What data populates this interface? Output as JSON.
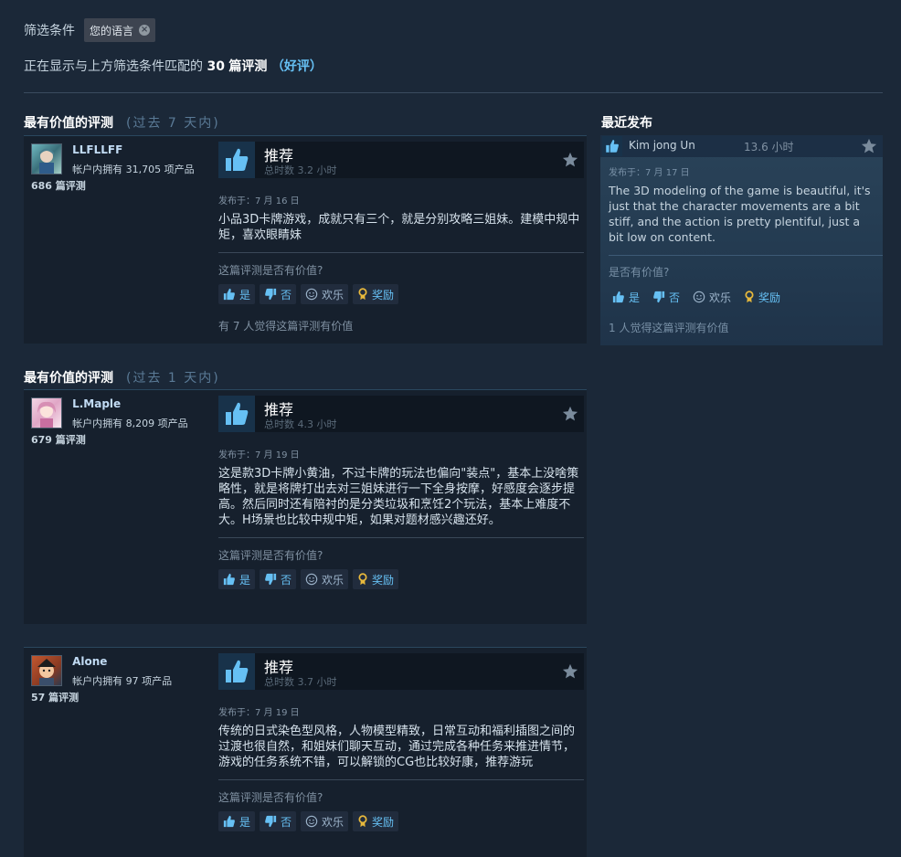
{
  "filter": {
    "label": "筛选条件",
    "chip": "您的语言"
  },
  "summary": {
    "prefix": "正在显示与上方筛选条件匹配的",
    "count": "30",
    "suffix": "篇评测",
    "paren_open": "（",
    "type": "好评",
    "paren_close": "）"
  },
  "sections": [
    {
      "title": "最有价值的评测",
      "period": "(过去 7 天内)"
    },
    {
      "title": "最有价值的评测",
      "period": "(过去 1 天内)"
    }
  ],
  "reviews": [
    {
      "author": "LLFLLFF",
      "products": "帐户内拥有 31,705 项产品",
      "review_count": "686 篇评测",
      "recommendation": "推荐",
      "hours": "总时数 3.2 小时",
      "posted": "发布于：7 月 16 日",
      "text": "小品3D卡牌游戏，成就只有三个，就是分别攻略三姐妹。建模中规中矩，喜欢眼睛妹",
      "helpful_q": "这篇评测是否有价值?",
      "found_helpful": "有 7 人觉得这篇评测有价值"
    },
    {
      "author": "L.Maple",
      "products": "帐户内拥有 8,209 项产品",
      "review_count": "679 篇评测",
      "recommendation": "推荐",
      "hours": "总时数 4.3 小时",
      "posted": "发布于：7 月 19 日",
      "text": "这是款3D卡牌小黄油，不过卡牌的玩法也偏向\"装点\"，基本上没啥策略性，就是将牌打出去对三姐妹进行一下全身按摩，好感度会逐步提高。然后同时还有陪衬的是分类垃圾和烹饪2个玩法，基本上难度不大。H场景也比较中规中矩，如果对题材感兴趣还好。",
      "helpful_q": "这篇评测是否有价值?",
      "found_helpful": ""
    },
    {
      "author": "Alone",
      "products": "帐户内拥有 97 项产品",
      "review_count": "57 篇评测",
      "recommendation": "推荐",
      "hours": "总时数 3.7 小时",
      "posted": "发布于：7 月 19 日",
      "text": "传统的日式染色型风格，人物模型精致，日常互动和福利插图之间的过渡也很自然，和姐妹们聊天互动，通过完成各种任务来推进情节，游戏的任务系统不错，可以解锁的CG也比较好康，推荐游玩",
      "helpful_q": "这篇评测是否有价值?",
      "found_helpful": ""
    }
  ],
  "buttons": {
    "yes": "是",
    "no": "否",
    "funny": "欢乐",
    "award": "奖励"
  },
  "recent": {
    "title": "最近发布",
    "author": "Kim jong Un",
    "hours": "13.6 小时",
    "posted": "发布于：7 月 17 日",
    "text": "The 3D modeling of the game is beautiful, it's just that the character movements are a bit stiff, and the action is pretty plentiful, just a bit low on content.",
    "helpful_q": "是否有价值?",
    "found_helpful": "1 人觉得这篇评测有价值"
  },
  "colors": {
    "background": "#1b2838",
    "accent": "#66c0f4",
    "card": "#16202d"
  }
}
